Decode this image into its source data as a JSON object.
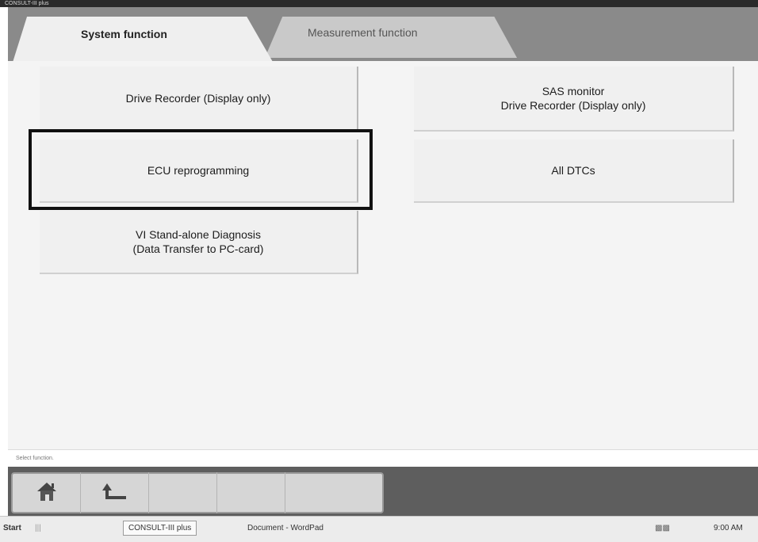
{
  "window": {
    "title": "CONSULT-III plus"
  },
  "tabs": [
    {
      "label": "System function",
      "active": true
    },
    {
      "label": "Measurement function",
      "active": false
    }
  ],
  "functions": {
    "drive_recorder": "Drive Recorder (Display only)",
    "sas_monitor_line1": "SAS monitor",
    "sas_monitor_line2": "Drive Recorder (Display only)",
    "ecu_reprogramming": "ECU reprogramming",
    "all_dtcs": "All DTCs",
    "vi_standalone_line1": "VI Stand-alone Diagnosis",
    "vi_standalone_line2": "(Data Transfer to PC-card)"
  },
  "status_message": "Select function.",
  "navigation": [
    {
      "name": "home",
      "icon": "home-icon"
    },
    {
      "name": "back",
      "icon": "back-arrow-icon"
    }
  ],
  "taskbar": {
    "start_label": "Start",
    "task_label": "CONSULT-III plus",
    "second_task": "Document - WordPad",
    "clock": "9:00 AM"
  },
  "colors": {
    "frame": "#8c8c8c",
    "active_tab": "#efefef",
    "inactive_tab": "#c9c9c9",
    "button_face": "#f0f0f0",
    "selection_border": "#111111",
    "nav_bar": "#5e5e5e"
  }
}
